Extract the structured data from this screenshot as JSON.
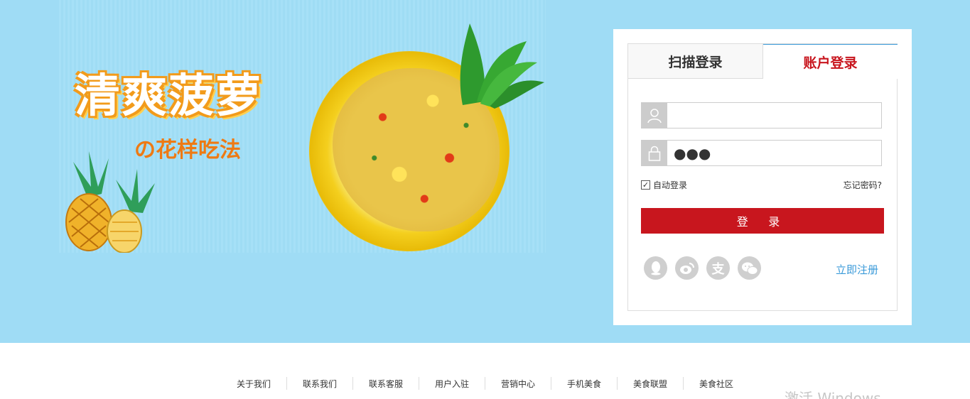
{
  "banner": {
    "title": "清爽菠萝",
    "subtitle": "の花样吃法"
  },
  "login": {
    "tabs": [
      {
        "label": "扫描登录",
        "active": false
      },
      {
        "label": "账户登录",
        "active": true
      }
    ],
    "username": {
      "value": "",
      "placeholder": ""
    },
    "password": {
      "value": "●●●",
      "placeholder": ""
    },
    "auto_login": {
      "label": "自动登录",
      "checked": true
    },
    "forgot_label": "忘记密码?",
    "submit_label": "登 录",
    "social_icons": [
      "qq-icon",
      "weibo-icon",
      "alipay-icon",
      "wechat-icon"
    ],
    "register_label": "立即注册"
  },
  "footer": {
    "links": [
      "关于我们",
      "联系我们",
      "联系客服",
      "用户入驻",
      "营销中心",
      "手机美食",
      "美食联盟",
      "美食社区"
    ]
  },
  "watermark": "激活 Windows",
  "colors": {
    "hero_bg": "#9fdcf5",
    "accent_red": "#c8161e",
    "link_blue": "#3a9ad9"
  }
}
